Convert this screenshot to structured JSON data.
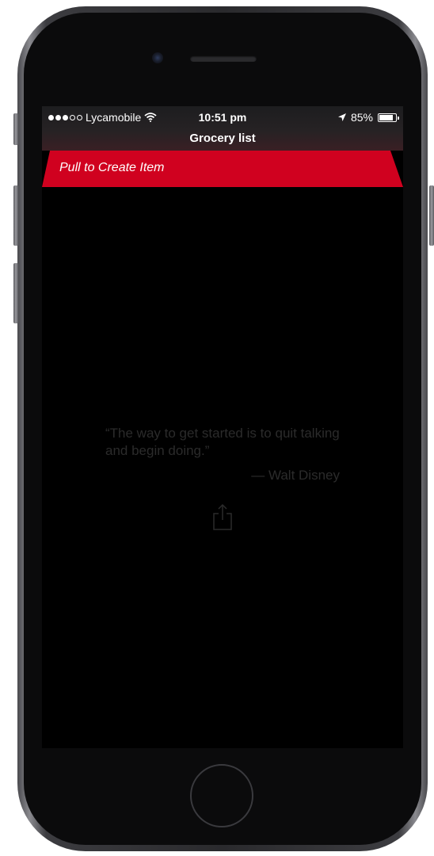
{
  "status_bar": {
    "carrier": "Lycamobile",
    "signal_bars_filled": 3,
    "signal_bars_total": 5,
    "time": "10:51 pm",
    "battery": "85%",
    "battery_level": 0.85
  },
  "nav": {
    "title": "Grocery list"
  },
  "list": {
    "pull_prompt": "Pull to Create Item"
  },
  "empty_state": {
    "quote": "“The way to get started is to quit talking and begin doing.”",
    "author": "— Walt Disney"
  },
  "colors": {
    "accent": "#d0011f",
    "background": "#000000"
  },
  "icons": [
    "wifi-icon",
    "location-arrow-icon",
    "battery-icon",
    "share-icon"
  ]
}
